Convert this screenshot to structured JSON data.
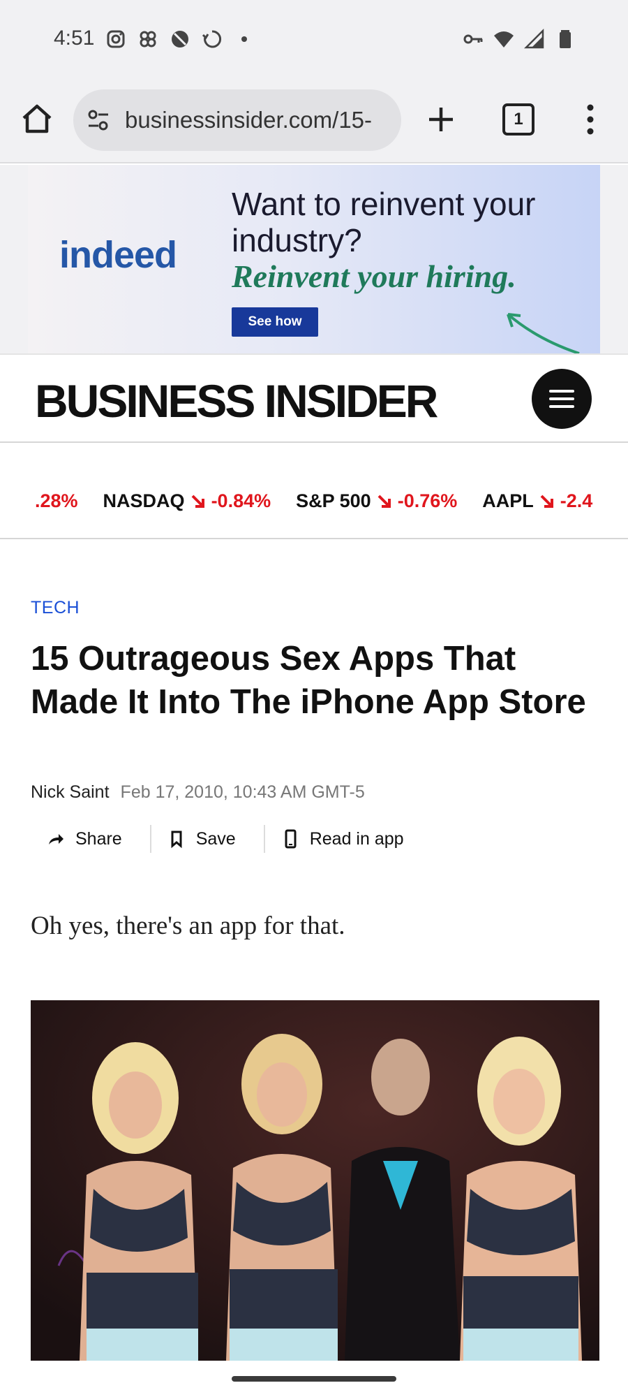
{
  "status_bar": {
    "time": "4:51",
    "left_icons": [
      "instagram-icon",
      "pinwheel-icon",
      "blocked-icon",
      "sync-icon",
      "dot-icon"
    ],
    "right_icons": [
      "vpn-key-icon",
      "wifi-icon",
      "signal-icon",
      "battery-icon"
    ]
  },
  "browser": {
    "url": "businessinsider.com/15-",
    "tab_count": "1"
  },
  "ad": {
    "brand": "indeed",
    "headline": "Want to reinvent your industry?",
    "tagline": "Reinvent your hiring.",
    "cta": "See how"
  },
  "site": {
    "logo": "BUSINESS INSIDER"
  },
  "ticker": [
    {
      "name": "",
      "value": ".28%"
    },
    {
      "name": "NASDAQ",
      "value": "-0.84%"
    },
    {
      "name": "S&P 500",
      "value": "-0.76%"
    },
    {
      "name": "AAPL",
      "value": "-2.4"
    }
  ],
  "article": {
    "category": "TECH",
    "headline": "15 Outrageous Sex Apps That Made It Into The iPhone App Store",
    "author": "Nick Saint",
    "date": "Feb 17, 2010, 10:43 AM GMT-5",
    "actions": {
      "share": "Share",
      "save": "Save",
      "read_in_app": "Read in app"
    },
    "lede": "Oh yes, there's an app for that."
  },
  "colors": {
    "ticker_down": "#e0161d",
    "category": "#1a4fd6",
    "indeed_blue": "#2557a7",
    "ad_green": "#1f7a5a"
  }
}
